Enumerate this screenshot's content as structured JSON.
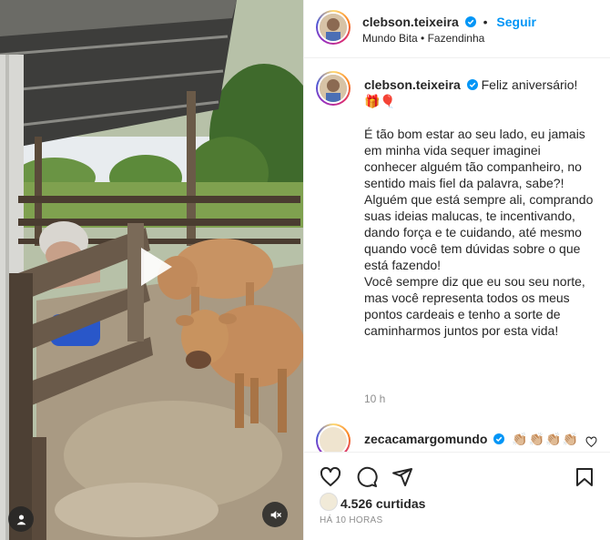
{
  "post": {
    "author": "clebson.teixeira",
    "follow_label": "Seguir",
    "audio": "Mundo Bita",
    "location": "Fazendinha",
    "caption_intro": "Feliz aniversário!",
    "caption_emojis": "🎁🎈",
    "caption_body": "É tão bom estar ao seu lado, eu jamais em minha vida sequer imaginei conhecer alguém tão companheiro, no sentido mais fiel da palavra, sabe?!\nAlguém que está sempre ali, comprando suas ideias malucas, te incentivando, dando força e te cuidando, até mesmo quando você tem dúvidas sobre o que está fazendo!\nVocê sempre diz que eu sou seu norte, mas você representa todos os meus pontos cardeais e tenho a sorte de caminharmos juntos por esta vida!",
    "caption_time": "10 h"
  },
  "comment": {
    "author": "zecacamargomundo",
    "text": "👏🏼👏🏼👏🏼👏🏼"
  },
  "footer": {
    "likes": "4.526 curtidas",
    "posted_ago": "HÁ 10 HORAS"
  },
  "icons": {
    "like": "heart-icon",
    "comment": "comment-icon",
    "share": "share-icon",
    "save": "bookmark-icon",
    "play": "play-icon",
    "mute": "speaker-muted-icon",
    "tagged": "user-icon",
    "verified": "verified-badge-icon"
  },
  "colors": {
    "link": "#0095f6",
    "verified": "#0095f6",
    "text": "#262626",
    "muted": "#8e8e8e"
  }
}
